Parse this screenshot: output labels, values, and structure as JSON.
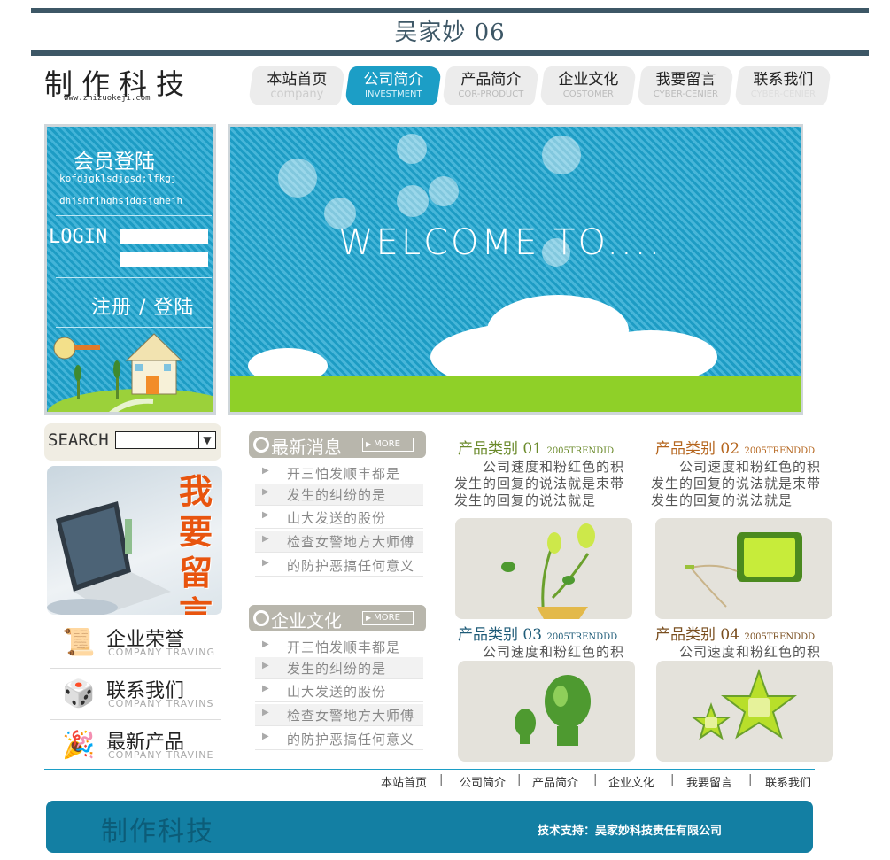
{
  "page": {
    "title": "吴家妙 06"
  },
  "logo": {
    "name": "制作科技",
    "url": "www.zhizuokeji.com"
  },
  "nav": [
    {
      "zh": "本站首页",
      "en": "company"
    },
    {
      "zh": "公司简介",
      "en": "INVESTMENT"
    },
    {
      "zh": "产品简介",
      "en": "COR-PRODUCT"
    },
    {
      "zh": "企业文化",
      "en": "COSTOMER"
    },
    {
      "zh": "我要留言",
      "en": "CYBER-CENIER"
    },
    {
      "zh": "联系我们",
      "en": "CYBER-CENIER"
    }
  ],
  "login": {
    "heading": "会员登陆",
    "line1": "kofdjgklsdjgsd;lfkgj",
    "line2": "dhjshfjhghsjdgsjghejh",
    "label": "LOGIN",
    "register": "注册 / 登陆"
  },
  "banner": {
    "text": "WELCOME TO...."
  },
  "search": {
    "label": "SEARCH",
    "arrow": "▼"
  },
  "message": {
    "text": "我要留言"
  },
  "left_links": [
    {
      "zh": "企业荣誉",
      "en": "COMPANY TRAVING",
      "icon": "📜"
    },
    {
      "zh": "联系我们",
      "en": "COMPANY TRAVINS",
      "icon": "🎲"
    },
    {
      "zh": "最新产品",
      "en": "COMPANY TRAVINE",
      "icon": "🎉"
    }
  ],
  "sections": [
    {
      "title": "最新消息",
      "more": "MORE",
      "items": [
        "开三怕发顺丰都是",
        "发生的纠纷的是",
        "山大发送的股份",
        "检查女警地方大师傅",
        "的防护恶搞任何意义"
      ]
    },
    {
      "title": "企业文化",
      "more": "MORE",
      "items": [
        "开三怕发顺丰都是",
        "发生的纠纷的是",
        "山大发送的股份",
        "检查女警地方大师傅",
        "的防护恶搞任何意义"
      ]
    }
  ],
  "products": [
    {
      "title": "产品类别 01",
      "tag": "2005TRENDID",
      "desc1": "　　公司速度和粉红色的积",
      "desc2": "发生的回复的说法就是束带",
      "desc3": "发生的回复的说法就是",
      "color": "#6a8a2a"
    },
    {
      "title": "产品类别 02",
      "tag": "2005TRENDDD",
      "desc1": "　　公司速度和粉红色的积",
      "desc2": "发生的回复的说法就是束带",
      "desc3": "发生的回复的说法就是",
      "color": "#b5651d"
    },
    {
      "title": "产品类别 03",
      "tag": "2005TRENDDD",
      "desc1": "　　公司速度和粉红色的积",
      "color": "#1e5b78"
    },
    {
      "title": "产品类别 04",
      "tag": "2005TRENDDD",
      "desc1": "　　公司速度和粉红色的积",
      "color": "#7a4f20"
    }
  ],
  "footer": {
    "nav": [
      "本站首页",
      "公司简介",
      "产品简介",
      "企业文化",
      "我要留言",
      "联系我们"
    ],
    "separator": "|",
    "logo": "制作科技",
    "support": "技术支持：吴家妙科技责任有限公司"
  }
}
